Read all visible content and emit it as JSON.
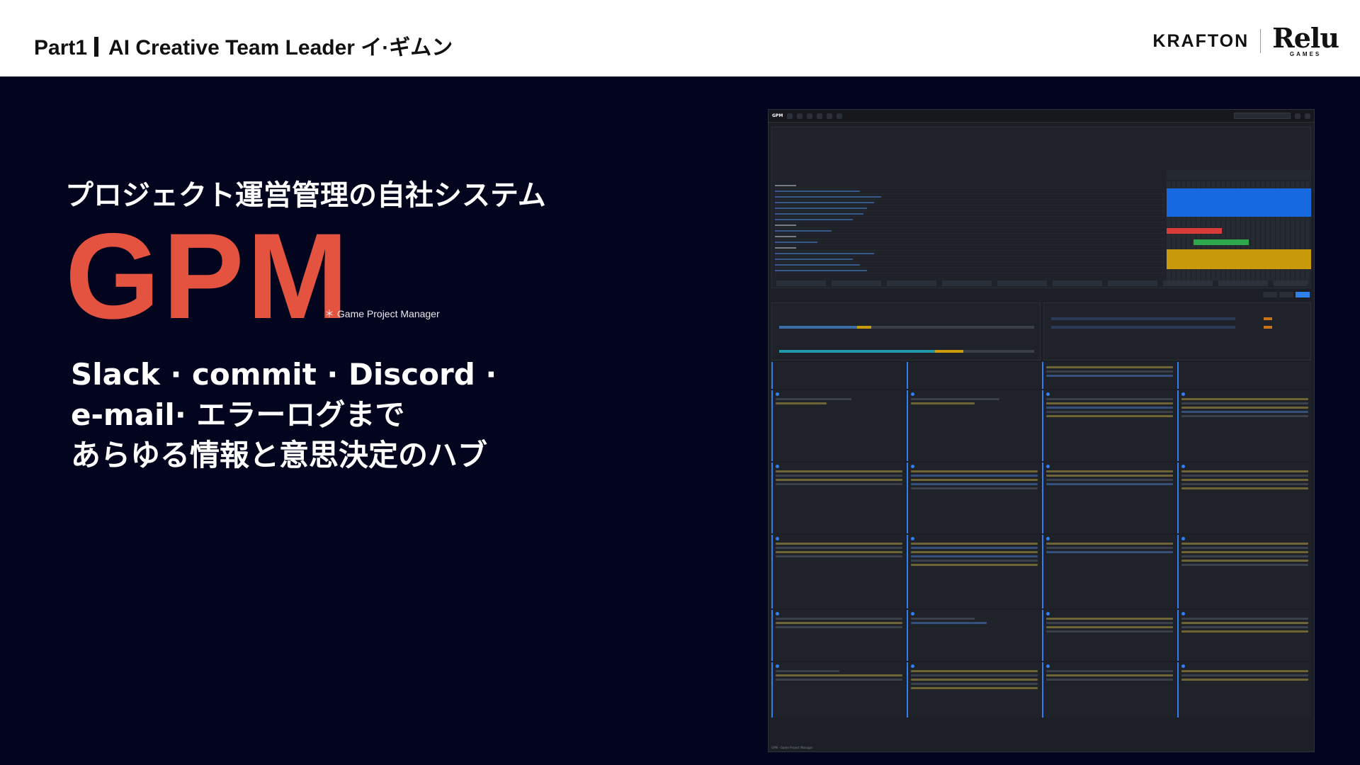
{
  "header": {
    "part": "Part1",
    "title": "AI Creative Team Leader イ·ギムン",
    "krafton": "KRAFTON",
    "relu": "Relu",
    "relu_sub": "GAMES"
  },
  "hero": {
    "subtitle": "プロジェクト運営管理の自社システム",
    "acronym": "GPM",
    "acronym_note": "＊ Game Project Manager",
    "desc_lines": [
      "Slack · commit · Discord ·",
      "e-mail· エラーログまで",
      "あらゆる情報と意思決定のハブ"
    ]
  },
  "screenshot": {
    "logo": "GPM",
    "footer_left": "GPM - Game Project Manager",
    "colors": {
      "blue": "#1769e0",
      "red": "#d93b3b",
      "green": "#2ea84a",
      "gold": "#c99a0a"
    }
  },
  "colors": {
    "background": "#03051f",
    "accent": "#e4533f"
  }
}
